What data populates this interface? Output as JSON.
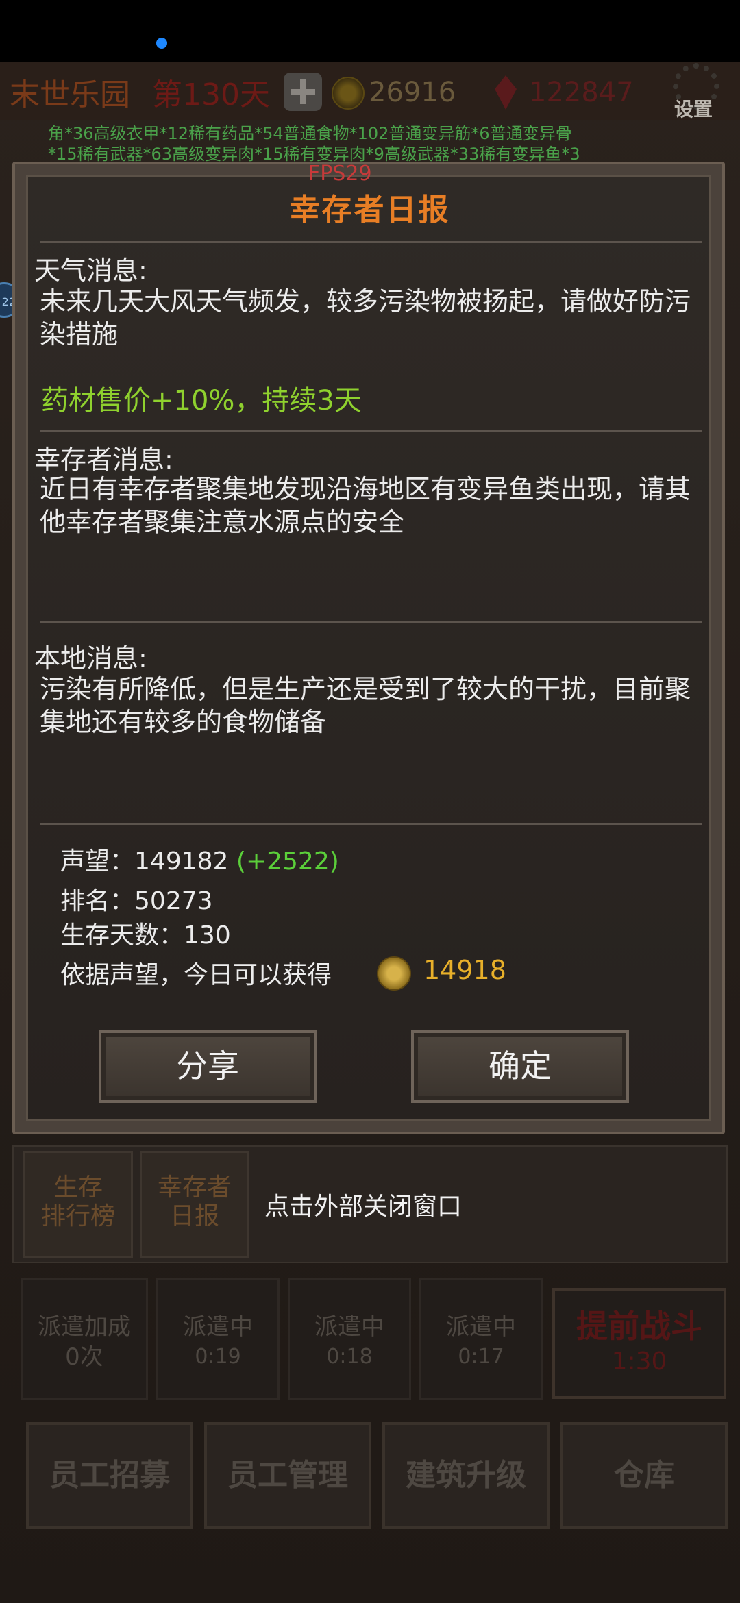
{
  "topbar": {
    "park_name": "末世乐园",
    "day": "第130天",
    "coins": "26916",
    "gems": "122847",
    "settings_label": "设置"
  },
  "ticker": {
    "line1": "角*36高级衣甲*12稀有药品*54普通食物*102普通变异筋*6普通变异骨",
    "line2": "*15稀有武器*63高级变异肉*15稀有变异肉*9高级武器*33稀有变异鱼*3"
  },
  "side_bubble": "22",
  "dialog": {
    "fps": "FPS29",
    "title": "幸存者日报",
    "weather": {
      "title": "天气消息:",
      "body": "未来几天大风天气频发，较多污染物被扬起，请做好防污染措施",
      "price_effect": "药材售价+10%，持续3天"
    },
    "survivor": {
      "title": "幸存者消息:",
      "body": "近日有幸存者聚集地发现沿海地区有变异鱼类出现，请其他幸存者聚集注意水源点的安全"
    },
    "local": {
      "title": "本地消息:",
      "body": "污染有所降低，但是生产还是受到了较大的干扰，目前聚集地还有较多的食物储备"
    },
    "stats": {
      "reputation_label": "声望：",
      "reputation_value": "149182",
      "reputation_gain": "(+2522)",
      "rank_label": "排名：",
      "rank_value": "50273",
      "days_label": "生存天数：",
      "days_value": "130",
      "reward_label": "依据声望，今日可以获得",
      "reward_value": "14918"
    },
    "buttons": {
      "share": "分享",
      "confirm": "确定"
    }
  },
  "lower": {
    "tab_ranking": "生存\n排行榜",
    "tab_daily": "幸存者\n日报",
    "close_hint": "点击外部关闭窗口",
    "dispatch_bonus_label": "派遣加成",
    "dispatch_bonus_count": "0次",
    "dispatch_label": "派遣中",
    "dispatch_times": [
      "0:19",
      "0:18",
      "0:17"
    ],
    "battle_label": "提前战斗",
    "battle_time": "1:30",
    "bottom_buttons": [
      "员工招募",
      "员工管理",
      "建筑升级",
      "仓库"
    ]
  },
  "colors": {
    "title_orange": "#e87e25",
    "green_effect": "#8fd12e",
    "gain_green": "#5bcf3a",
    "coin_gold": "#e8b02a"
  }
}
